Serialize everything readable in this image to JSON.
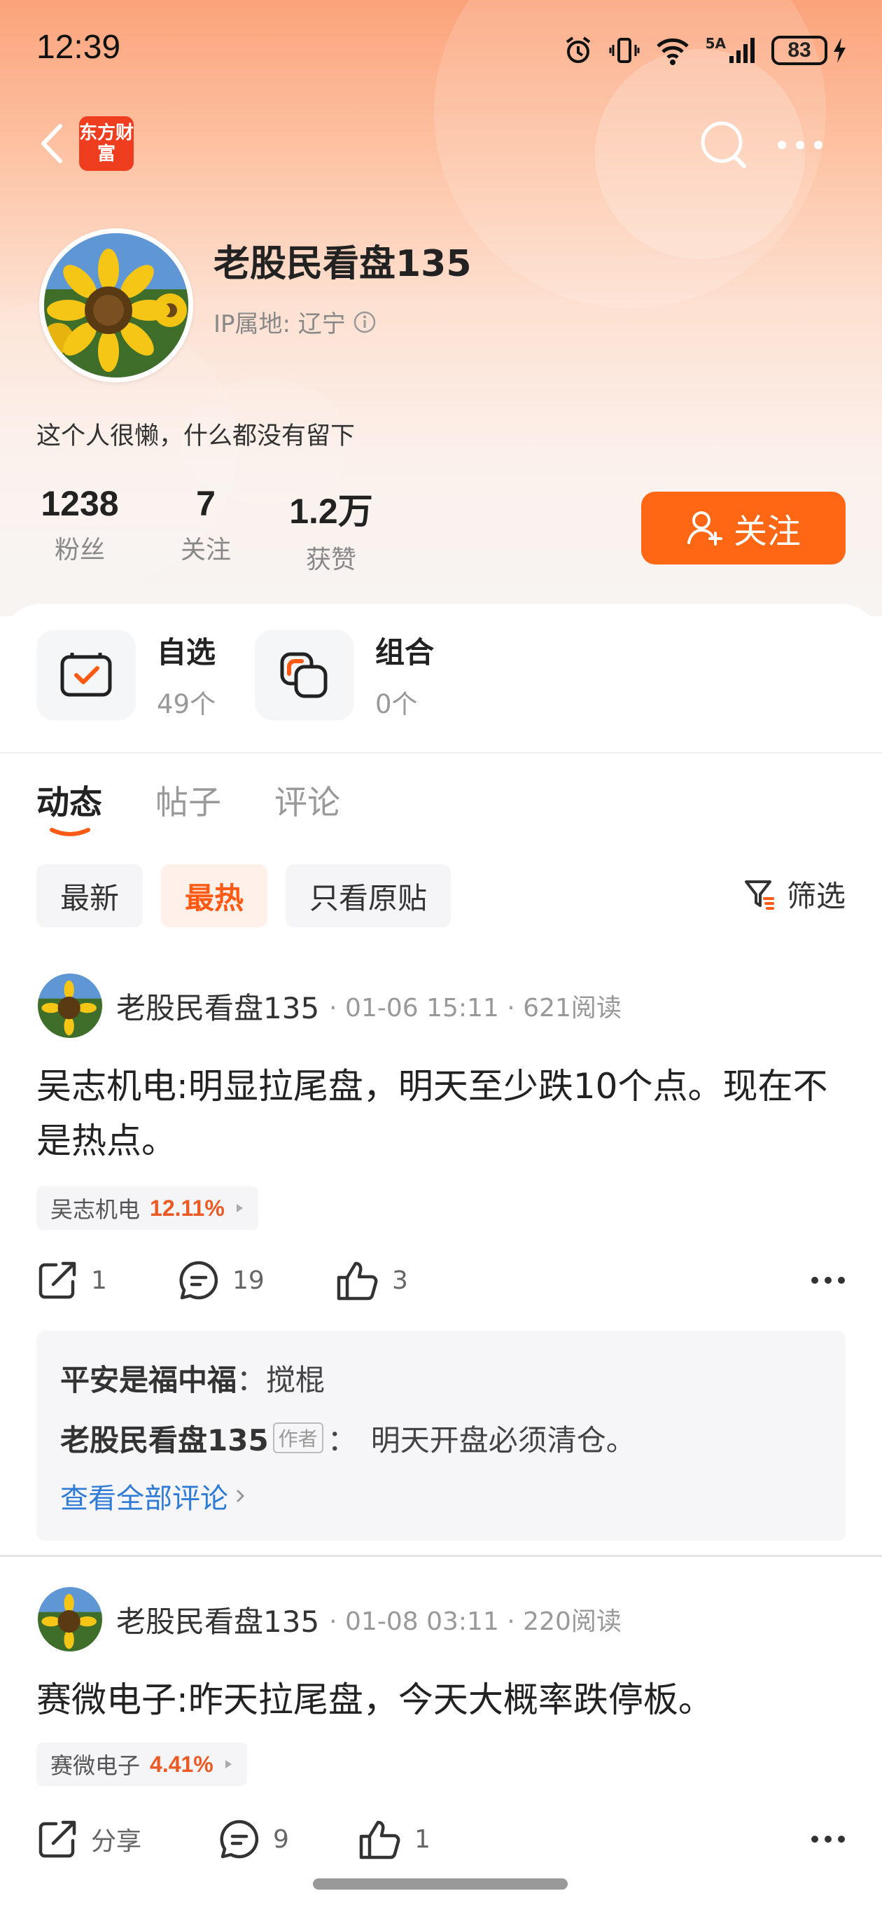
{
  "status_bar": {
    "time": "12:39",
    "network": "5A",
    "battery": "83"
  },
  "header": {
    "logo_text": "东方财富"
  },
  "profile": {
    "username": "老股民看盘135",
    "ip_location": "IP属地: 辽宁",
    "bio": "这个人很懒，什么都没有留下",
    "stats": [
      {
        "value": "1238",
        "label": "粉丝"
      },
      {
        "value": "7",
        "label": "关注"
      },
      {
        "value": "1.2万",
        "label": "获赞"
      }
    ],
    "follow_label": "关注"
  },
  "assets": [
    {
      "title": "自选",
      "count": "49个"
    },
    {
      "title": "组合",
      "count": "0个"
    }
  ],
  "tabs": [
    "动态",
    "帖子",
    "评论"
  ],
  "filters": {
    "chips": [
      "最新",
      "最热",
      "只看原贴"
    ],
    "filter_label": "筛选"
  },
  "posts": [
    {
      "author": "老股民看盘135",
      "meta": "· 01-06 15:11 · 621阅读",
      "text": "吴志机电:明显拉尾盘，明天至少跌10个点。现在不是热点。",
      "stock": {
        "name": "吴志机电",
        "pct": "12.11%"
      },
      "share": "1",
      "comments": "19",
      "likes": "3",
      "replies": [
        {
          "user": "平安是福中福",
          "text": "搅棍"
        },
        {
          "user": "老股民看盘135",
          "badge": "作者",
          "text": "明天开盘必须清仓。"
        }
      ],
      "view_all": "查看全部评论"
    },
    {
      "author": "老股民看盘135",
      "meta": "· 01-08 03:11 · 220阅读",
      "text": "赛微电子:昨天拉尾盘，今天大概率跌停板。",
      "stock": {
        "name": "赛微电子",
        "pct": "4.41%"
      },
      "share": "分享",
      "comments": "9",
      "likes": "1"
    }
  ],
  "colors": {
    "accent": "#ff6714",
    "stock_up": "#ea5a24",
    "link": "#2f7bd6"
  }
}
